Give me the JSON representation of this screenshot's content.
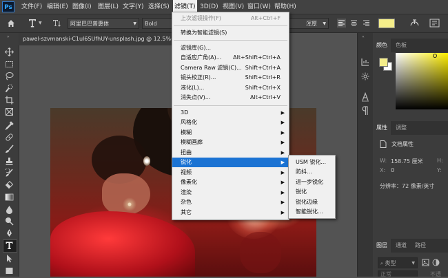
{
  "app": {
    "logo": "Ps"
  },
  "menubar": {
    "items": [
      {
        "label": "文件(F)"
      },
      {
        "label": "编辑(E)"
      },
      {
        "label": "图像(I)"
      },
      {
        "label": "图层(L)"
      },
      {
        "label": "文字(Y)"
      },
      {
        "label": "选择(S)"
      },
      {
        "label": "滤镜(T)"
      },
      {
        "label": "3D(D)"
      },
      {
        "label": "视图(V)"
      },
      {
        "label": "窗口(W)"
      },
      {
        "label": "帮助(H)"
      }
    ]
  },
  "options_bar": {
    "font_family": "阿里巴巴普惠体",
    "font_style": "Bold",
    "anti_alias": "浑厚"
  },
  "document": {
    "tab_title": "pawel-szvmanski-C1ul6SUfhUY-unsplash.jpg @ 12.5%(RG"
  },
  "filter_menu": {
    "items": [
      {
        "label": "上次滤镜操作(F)",
        "shortcut": "Alt+Ctrl+F",
        "disabled": true
      },
      {
        "label": "转换为智能滤镜(S)",
        "shortcut": ""
      },
      {
        "label": "滤镜库(G)...",
        "shortcut": ""
      },
      {
        "label": "自适应广角(A)...",
        "shortcut": "Alt+Shift+Ctrl+A"
      },
      {
        "label": "Camera Raw 滤镜(C)...",
        "shortcut": "Shift+Ctrl+A"
      },
      {
        "label": "镜头校正(R)...",
        "shortcut": "Shift+Ctrl+R"
      },
      {
        "label": "液化(L)...",
        "shortcut": "Shift+Ctrl+X"
      },
      {
        "label": "消失点(V)...",
        "shortcut": "Alt+Ctrl+V"
      },
      {
        "label": "3D",
        "submenu": true
      },
      {
        "label": "风格化",
        "submenu": true
      },
      {
        "label": "模糊",
        "submenu": true
      },
      {
        "label": "模糊画廊",
        "submenu": true
      },
      {
        "label": "扭曲",
        "submenu": true
      },
      {
        "label": "锐化",
        "submenu": true,
        "highlighted": true
      },
      {
        "label": "视频",
        "submenu": true
      },
      {
        "label": "像素化",
        "submenu": true
      },
      {
        "label": "渲染",
        "submenu": true
      },
      {
        "label": "杂色",
        "submenu": true
      },
      {
        "label": "其它",
        "submenu": true
      }
    ]
  },
  "sharpen_submenu": {
    "items": [
      {
        "label": "USM 锐化..."
      },
      {
        "label": "防抖..."
      },
      {
        "label": "进一步锐化"
      },
      {
        "label": "锐化"
      },
      {
        "label": "锐化边缘"
      },
      {
        "label": "智能锐化..."
      }
    ]
  },
  "color_panel": {
    "tabs": [
      "颜色",
      "色板"
    ],
    "foreground": "#f5ee8a",
    "background": "#ffffff"
  },
  "properties_panel": {
    "tabs": [
      "属性",
      "调整"
    ],
    "section": "文档属性",
    "w_label": "W:",
    "w_value": "158.75 厘米",
    "h_label": "H:",
    "x_label": "X:",
    "x_value": "0",
    "y_label": "Y:",
    "resolution": "分辨率：72 像素/英寸"
  },
  "layers_panel": {
    "tabs": [
      "图层",
      "通道",
      "路径"
    ],
    "filter_placeholder": "类型",
    "mode": "正常",
    "opacity_label": "不透"
  },
  "colors": {
    "highlight": "#1b73d3",
    "menu_bg": "#f0f0f0",
    "ui_dark": "#3c3c3c"
  }
}
